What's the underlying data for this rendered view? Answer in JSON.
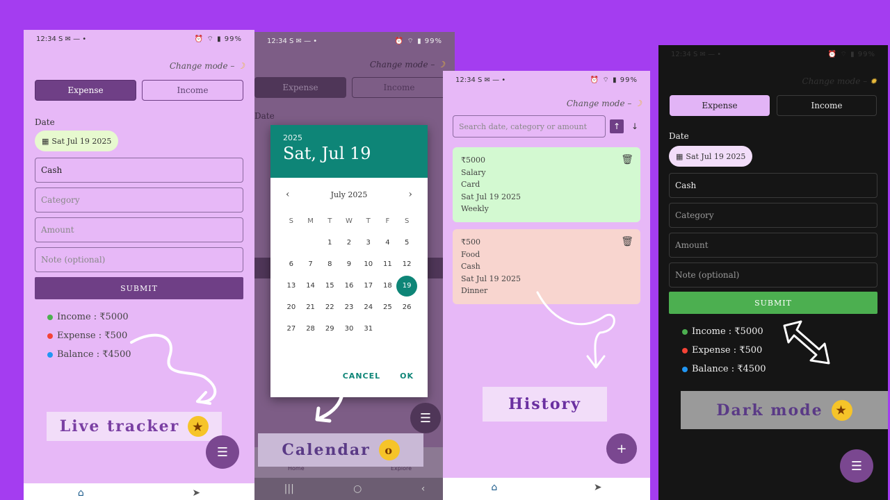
{
  "status": {
    "time": "12:34",
    "indicators": "S ✉ — •",
    "battery": "99%"
  },
  "change_mode": "Change mode –",
  "tabs": {
    "expense": "Expense",
    "income": "Income"
  },
  "form": {
    "date_label": "Date",
    "date_value": "Sat Jul 19 2025",
    "payment": "Cash",
    "category_placeholder": "Category",
    "amount_placeholder": "Amount",
    "note_placeholder": "Note (optional)",
    "submit": "SUBMIT"
  },
  "summary": {
    "income": "Income : ₹5000",
    "expense": "Expense : ₹500",
    "balance": "Balance : ₹4500"
  },
  "captions": {
    "live": "Live tracker",
    "calendar": "Calendar",
    "history": "History",
    "dark": "Dark mode"
  },
  "nav": {
    "home": "Home",
    "explore": "Explore"
  },
  "calendar": {
    "year": "2025",
    "selected_title": "Sat, Jul 19",
    "month": "July 2025",
    "dow": [
      "S",
      "M",
      "T",
      "W",
      "T",
      "F",
      "S"
    ],
    "weeks": [
      [
        "",
        "",
        "1",
        "2",
        "3",
        "4",
        "5"
      ],
      [
        "6",
        "7",
        "8",
        "9",
        "10",
        "11",
        "12"
      ],
      [
        "13",
        "14",
        "15",
        "16",
        "17",
        "18",
        "19"
      ],
      [
        "20",
        "21",
        "22",
        "23",
        "24",
        "25",
        "26"
      ],
      [
        "27",
        "28",
        "29",
        "30",
        "31",
        "",
        ""
      ]
    ],
    "selected_day": "19",
    "cancel": "CANCEL",
    "ok": "OK"
  },
  "history": {
    "search_placeholder": "Search date, category or amount",
    "entries": [
      {
        "amount": "₹5000",
        "category": "Salary",
        "method": "Card",
        "date": "Sat Jul 19 2025",
        "note": "Weekly",
        "type": "income"
      },
      {
        "amount": "₹500",
        "category": "Food",
        "method": "Cash",
        "date": "Sat Jul 19 2025",
        "note": "Dinner",
        "type": "expense"
      }
    ]
  },
  "colors": {
    "background": "#a43df0",
    "accent": "#6f3f86",
    "teal": "#0e8577",
    "income": "#4caf50",
    "expense": "#f44336",
    "balance": "#2196f3"
  }
}
